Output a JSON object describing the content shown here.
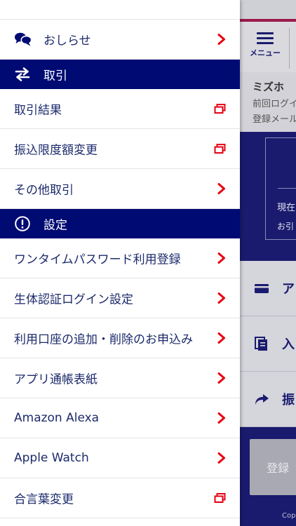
{
  "drawer": {
    "news": {
      "label": "おしらせ",
      "icon": "chat-bubbles-icon"
    },
    "sections": [
      {
        "title": "取引",
        "icon": "swap-arrows-icon",
        "items": [
          {
            "label": "取引結果",
            "action": "external"
          },
          {
            "label": "振込限度額変更",
            "action": "external"
          },
          {
            "label": "その他取引",
            "action": "chevron"
          }
        ]
      },
      {
        "title": "設定",
        "icon": "exclamation-circle-icon",
        "items": [
          {
            "label": "ワンタイムパスワード利用登録",
            "action": "chevron"
          },
          {
            "label": "生体認証ログイン設定",
            "action": "chevron"
          },
          {
            "label": "利用口座の追加・削除のお申込み",
            "action": "chevron"
          },
          {
            "label": "アプリ通帳表紙",
            "action": "chevron"
          },
          {
            "label": "Amazon Alexa",
            "action": "chevron"
          },
          {
            "label": "Apple Watch",
            "action": "chevron"
          },
          {
            "label": "合言葉変更",
            "action": "external"
          }
        ]
      }
    ]
  },
  "background": {
    "menu_label": "メニュー",
    "bank_name": "ミズホ",
    "info_line1": "前回ログイ",
    "info_line2": "登録メール",
    "box_line1": "現在",
    "box_line2": "お引",
    "list": [
      {
        "text": "ア",
        "icon": "card-icon"
      },
      {
        "text": "入",
        "icon": "copy-docs-icon"
      },
      {
        "text": "振",
        "icon": "share-arrow-icon"
      }
    ],
    "register_button": "登録",
    "copyright": "Cop"
  },
  "colors": {
    "navy": "#000a73",
    "text_blue": "#1c2a6b",
    "accent_red": "#e60012"
  }
}
